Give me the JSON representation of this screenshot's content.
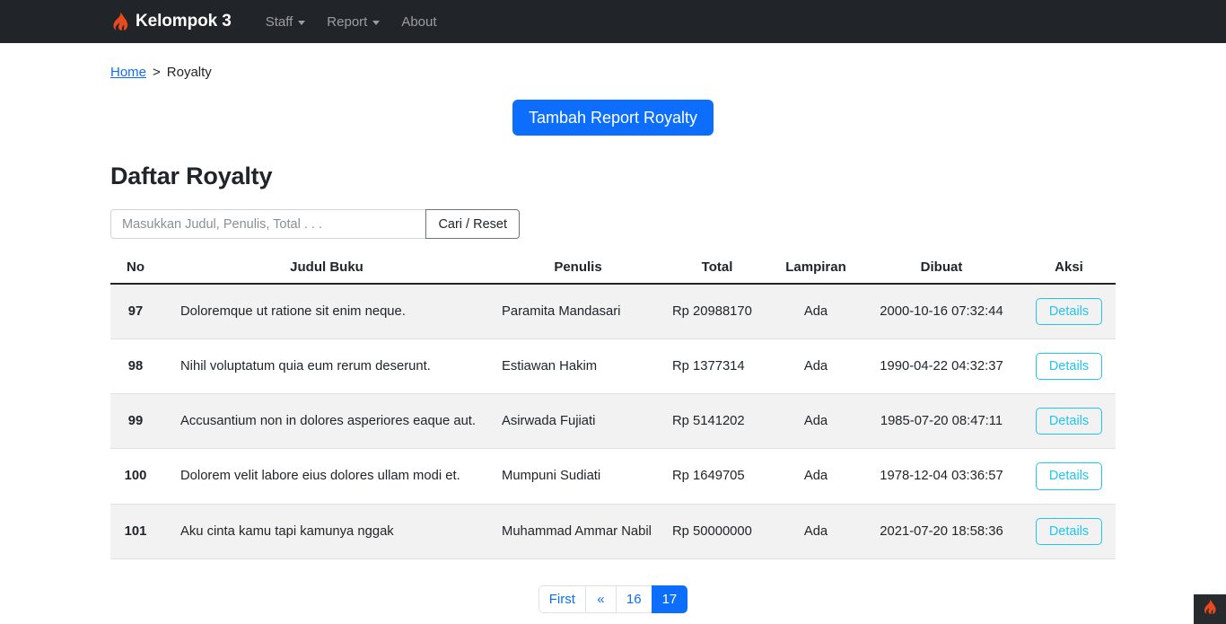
{
  "navbar": {
    "brand": "Kelompok 3",
    "brand_icon": "flame-icon",
    "items": [
      {
        "label": "Staff",
        "has_caret": true
      },
      {
        "label": "Report",
        "has_caret": true
      },
      {
        "label": "About",
        "has_caret": false
      }
    ]
  },
  "breadcrumb": {
    "home": "Home",
    "separator": ">",
    "current": "Royalty"
  },
  "actions": {
    "add_label": "Tambah Report Royalty"
  },
  "page": {
    "title": "Daftar Royalty"
  },
  "search": {
    "placeholder": "Masukkan Judul, Penulis, Total . . .",
    "value": "",
    "button_label": "Cari / Reset"
  },
  "table": {
    "headers": {
      "no": "No",
      "judul": "Judul Buku",
      "penulis": "Penulis",
      "total": "Total",
      "lampiran": "Lampiran",
      "dibuat": "Dibuat",
      "aksi": "Aksi"
    },
    "action_label": "Details",
    "rows": [
      {
        "no": "97",
        "judul": "Doloremque ut ratione sit enim neque.",
        "penulis": "Paramita Mandasari",
        "total": "Rp 20988170",
        "lampiran": "Ada",
        "dibuat": "2000-10-16 07:32:44"
      },
      {
        "no": "98",
        "judul": "Nihil voluptatum quia eum rerum deserunt.",
        "penulis": "Estiawan Hakim",
        "total": "Rp 1377314",
        "lampiran": "Ada",
        "dibuat": "1990-04-22 04:32:37"
      },
      {
        "no": "99",
        "judul": "Accusantium non in dolores asperiores eaque aut.",
        "penulis": "Asirwada Fujiati",
        "total": "Rp 5141202",
        "lampiran": "Ada",
        "dibuat": "1985-07-20 08:47:11"
      },
      {
        "no": "100",
        "judul": "Dolorem velit labore eius dolores ullam modi et.",
        "penulis": "Mumpuni Sudiati",
        "total": "Rp 1649705",
        "lampiran": "Ada",
        "dibuat": "1978-12-04 03:36:57"
      },
      {
        "no": "101",
        "judul": "Aku cinta kamu tapi kamunya nggak",
        "penulis": "Muhammad Ammar Nabil",
        "total": "Rp 50000000",
        "lampiran": "Ada",
        "dibuat": "2021-07-20 18:58:36"
      }
    ]
  },
  "pagination": {
    "items": [
      {
        "label": "First",
        "active": false
      },
      {
        "label": "«",
        "active": false
      },
      {
        "label": "16",
        "active": false
      },
      {
        "label": "17",
        "active": true
      }
    ]
  },
  "corner_widget": {
    "icon": "flame-icon"
  },
  "colors": {
    "navbar_bg": "#212529",
    "primary": "#0d6efd",
    "info": "#22c5f0",
    "flame": "#e8491d",
    "stripe": "#f2f2f2",
    "border": "#dee2e6"
  }
}
